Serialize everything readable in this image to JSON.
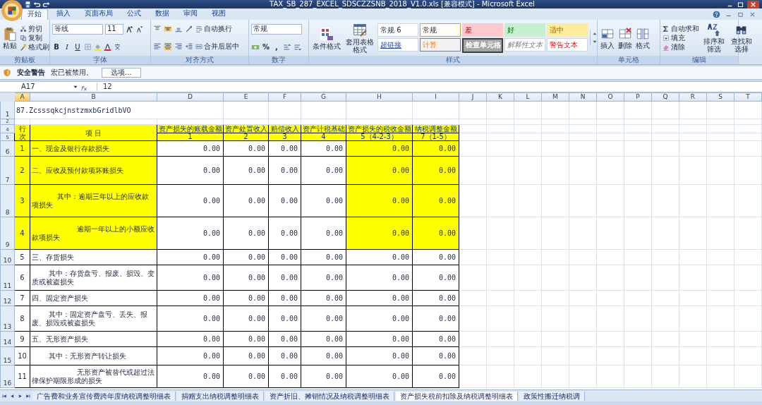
{
  "window": {
    "title": "TAX_SB_287_EXCEL_SDSCZZSNB_2018_V1.0.xls [兼容模式] - Microsoft Excel"
  },
  "ribbon_tabs": [
    {
      "label": "开始",
      "selected": true
    },
    {
      "label": "插入",
      "selected": false
    },
    {
      "label": "页面布局",
      "selected": false
    },
    {
      "label": "公式",
      "selected": false
    },
    {
      "label": "数据",
      "selected": false
    },
    {
      "label": "审阅",
      "selected": false
    },
    {
      "label": "视图",
      "selected": false
    }
  ],
  "clipboard": {
    "label": "剪贴板",
    "paste": "粘贴",
    "items": [
      "剪切",
      "复制",
      "格式刷"
    ]
  },
  "font": {
    "label": "字体",
    "name": "等线",
    "size": "11",
    "buttons": [
      "B",
      "I",
      "U"
    ]
  },
  "alignment": {
    "label": "对齐方式",
    "wrap": "自动换行",
    "merge": "合并后居中"
  },
  "number": {
    "label": "数字",
    "format": "常规",
    "symbols": [
      "%",
      ","
    ]
  },
  "styles": {
    "label": "样式",
    "buttons": [
      "条件格式",
      "套用表格格式"
    ],
    "cells": [
      {
        "text": "常规 6",
        "kind": "normal"
      },
      {
        "text": "常规",
        "kind": "current"
      },
      {
        "text": "差",
        "kind": "bad"
      },
      {
        "text": "好",
        "kind": "good"
      },
      {
        "text": "适中",
        "kind": "neutral"
      },
      {
        "text": "超链接",
        "kind": "link"
      },
      {
        "text": "计算",
        "kind": "calc"
      },
      {
        "text": "检查单元格",
        "kind": "check"
      },
      {
        "text": "解释性文本",
        "kind": "note"
      },
      {
        "text": "警告文本",
        "kind": "warn"
      }
    ]
  },
  "cells_group": {
    "label": "单元格",
    "buttons": [
      "插入",
      "删除",
      "格式"
    ]
  },
  "editing": {
    "label": "编辑",
    "items": [
      "自动求和",
      "填充",
      "清除"
    ],
    "buttons": [
      "排序和筛选",
      "查找和选择"
    ]
  },
  "security_bar": {
    "title": "安全警告",
    "message": "宏已被禁用。",
    "button": "选项..."
  },
  "formula_bar": {
    "name_box": "A17",
    "value": "12"
  },
  "columns": [
    {
      "label": "A",
      "selected": true
    },
    {
      "label": "B",
      "selected": false
    },
    {
      "label": "D",
      "selected": false
    },
    {
      "label": "E",
      "selected": false
    },
    {
      "label": "F",
      "selected": false
    },
    {
      "label": "G",
      "selected": false
    },
    {
      "label": "H",
      "selected": false
    },
    {
      "label": "I",
      "selected": false
    },
    {
      "label": "J",
      "selected": false
    },
    {
      "label": "K",
      "selected": false
    },
    {
      "label": "L",
      "selected": false
    },
    {
      "label": "M",
      "selected": false
    },
    {
      "label": "N",
      "selected": false
    },
    {
      "label": "O",
      "selected": false
    },
    {
      "label": "P",
      "selected": false
    },
    {
      "label": "Q",
      "selected": false
    },
    {
      "label": "R",
      "selected": false
    },
    {
      "label": "S",
      "selected": false
    },
    {
      "label": "T",
      "selected": false
    }
  ],
  "sheet": {
    "title_row": {
      "row_number": "1",
      "text": "87.ZcsssqkcjnstzmxbGridlbVO"
    },
    "blank_row": "2",
    "header_rows": [
      "4",
      "5"
    ],
    "headers": {
      "line": "行次",
      "item": "项 目",
      "values": [
        {
          "label": "资产损失的账载金额",
          "number": "1"
        },
        {
          "label": "资产处置收入",
          "number": "2"
        },
        {
          "label": "赔偿收入",
          "number": "3"
        },
        {
          "label": "资产计税基础",
          "number": "4"
        },
        {
          "label": "资产损失的税收金额",
          "number": "5（4-2-3）"
        },
        {
          "label": "纳税调整金额",
          "number": "7（1-5）"
        }
      ]
    },
    "rows": [
      {
        "row_number": "6",
        "line": "1",
        "item": "一、现金及银行存款损失",
        "kind": "main",
        "highlight": true,
        "values": [
          "0.00",
          "0.00",
          "0.00",
          "0.00",
          "0.00",
          "0.00"
        ]
      },
      {
        "row_number": "7",
        "line": "2",
        "item": "二、应收及预付款项坏账损失",
        "kind": "main",
        "highlight": true,
        "values": [
          "0.00",
          "0.00",
          "0.00",
          "0.00",
          "0.00",
          "0.00"
        ]
      },
      {
        "row_number": "8",
        "line": "3",
        "item": "其中：逾期三年以上的应收款项损失",
        "kind": "sub2",
        "highlight": true,
        "values": [
          "0.00",
          "0.00",
          "0.00",
          "0.00",
          "0.00",
          "0.00"
        ]
      },
      {
        "row_number": "9",
        "line": "4",
        "item": "逾期一年以上的小额应收款项损失",
        "kind": "sub3",
        "highlight": true,
        "values": [
          "0.00",
          "0.00",
          "0.00",
          "0.00",
          "0.00",
          "0.00"
        ]
      },
      {
        "row_number": "10",
        "line": "5",
        "item": "三、存货损失",
        "kind": "main",
        "highlight": false,
        "values": [
          "0.00",
          "0.00",
          "0.00",
          "0.00",
          "0.00",
          "0.00"
        ]
      },
      {
        "row_number": "11",
        "line": "6",
        "item": "其中：存货盘亏、报废、损毁、变质或被盗损失",
        "kind": "sub",
        "highlight": false,
        "values": [
          "0.00",
          "0.00",
          "0.00",
          "0.00",
          "0.00",
          "0.00"
        ]
      },
      {
        "row_number": "12",
        "line": "7",
        "item": "四、固定资产损失",
        "kind": "main",
        "highlight": false,
        "values": [
          "0.00",
          "0.00",
          "0.00",
          "0.00",
          "0.00",
          "0.00"
        ]
      },
      {
        "row_number": "13",
        "line": "8",
        "item": "其中：固定资产盘亏、丢失、报废、损毁或被盗损失",
        "kind": "sub",
        "highlight": false,
        "values": [
          "0.00",
          "0.00",
          "0.00",
          "0.00",
          "0.00",
          "0.00"
        ]
      },
      {
        "row_number": "14",
        "line": "9",
        "item": "五、无形资产损失",
        "kind": "main",
        "highlight": false,
        "values": [
          "0.00",
          "0.00",
          "0.00",
          "0.00",
          "0.00",
          "0.00"
        ]
      },
      {
        "row_number": "15",
        "line": "10",
        "item": "其中：无形资产转让损失",
        "kind": "sub",
        "highlight": false,
        "values": [
          "0.00",
          "0.00",
          "0.00",
          "0.00",
          "0.00",
          "0.00"
        ]
      },
      {
        "row_number": "16",
        "line": "11",
        "item": "无形资产被替代或超过法律保护期限形成的损失",
        "kind": "sub3",
        "highlight": false,
        "values": [
          "0.00",
          "0.00",
          "0.00",
          "0.00",
          "0.00",
          "0.00"
        ]
      }
    ]
  },
  "sheet_tabs": [
    {
      "label": "广告费和业务宣传费跨年度纳税调整明细表",
      "selected": false
    },
    {
      "label": "捐赠支出纳税调整明细表",
      "selected": false
    },
    {
      "label": "资产折旧、摊销情况及纳税调整明细表",
      "selected": false
    },
    {
      "label": "资产损失税前扣除及纳税调整明细表",
      "selected": true
    },
    {
      "label": "政策性搬迁纳税调",
      "selected": false
    }
  ]
}
